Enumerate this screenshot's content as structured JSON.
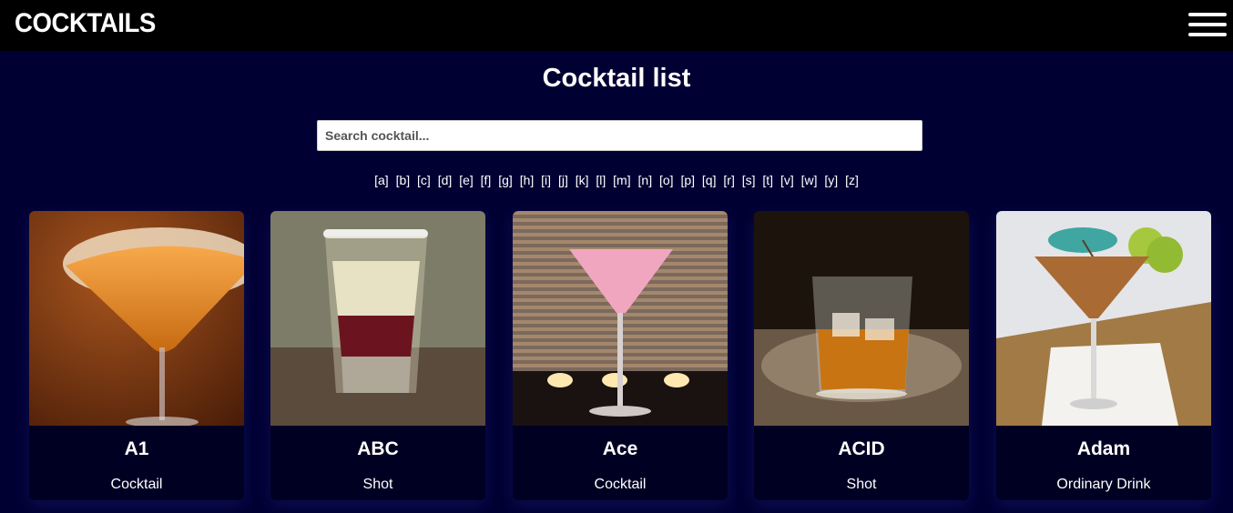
{
  "navbar": {
    "brand": "COCKTAILS",
    "menu_icon": "hamburger-menu-icon"
  },
  "page": {
    "title": "Cocktail list"
  },
  "search": {
    "placeholder": "Search cocktail...",
    "value": ""
  },
  "letters": [
    "[a]",
    "[b]",
    "[c]",
    "[d]",
    "[e]",
    "[f]",
    "[g]",
    "[h]",
    "[i]",
    "[j]",
    "[k]",
    "[l]",
    "[m]",
    "[n]",
    "[o]",
    "[p]",
    "[q]",
    "[r]",
    "[s]",
    "[t]",
    "[v]",
    "[w]",
    "[y]",
    "[z]"
  ],
  "cocktails": [
    {
      "name": "A1",
      "category": "Cocktail"
    },
    {
      "name": "ABC",
      "category": "Shot"
    },
    {
      "name": "Ace",
      "category": "Cocktail"
    },
    {
      "name": "ACID",
      "category": "Shot"
    },
    {
      "name": "Adam",
      "category": "Ordinary Drink"
    }
  ],
  "colors": {
    "background": "#000033",
    "navbar": "#000000",
    "card": "#000022",
    "text": "#ffffff"
  }
}
